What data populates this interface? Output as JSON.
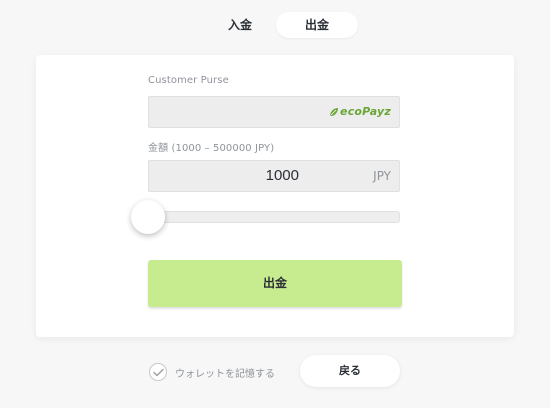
{
  "tabs": {
    "deposit": "入金",
    "withdraw": "出金"
  },
  "form": {
    "customer_purse_label": "Customer Purse",
    "payment_method_logo": "ecoPayz",
    "amount_label": "金額 (1000 – 500000 JPY)",
    "amount_value": "1000",
    "currency": "JPY",
    "slider_level": 0,
    "withdraw_button": "出金"
  },
  "footer": {
    "remember_wallet_label": "ウォレットを記憶する",
    "back_button": "戻る"
  },
  "icons": {
    "logo_leaf": "leaf-icon",
    "check": "check-icon"
  },
  "colors": {
    "accent_button": "#c7eb8f",
    "eco_green": "#6aa536",
    "background": "#f7f7f7"
  }
}
